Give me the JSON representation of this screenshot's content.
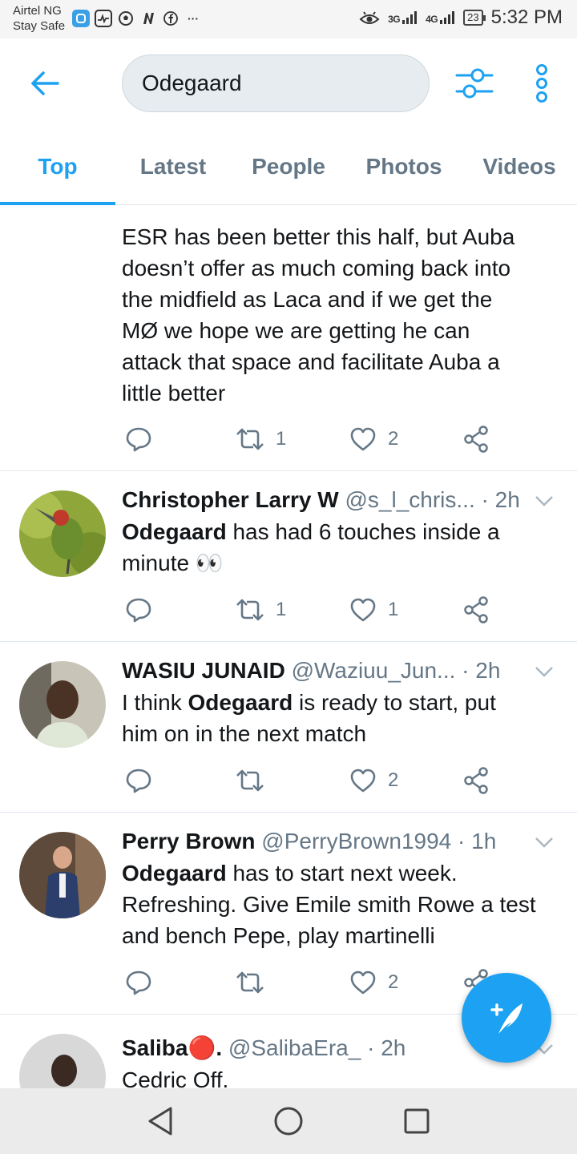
{
  "status_bar": {
    "carrier": "Airtel NG",
    "carrier_sub": "Stay Safe",
    "net_3g": "3G",
    "net_4g": "4G",
    "battery": "23",
    "time": "5:32 PM",
    "more_dots": "···"
  },
  "search": {
    "query": "Odegaard"
  },
  "tabs": [
    {
      "label": "Top",
      "active": true
    },
    {
      "label": "Latest"
    },
    {
      "label": "People"
    },
    {
      "label": "Photos"
    },
    {
      "label": "Videos"
    }
  ],
  "tweets": [
    {
      "body_lines": [
        "ESR has been better this half, but Auba",
        "doesn’t offer as much coming back into",
        "the midfield as Laca and if we get the",
        "MØ we hope we are getting he can",
        "attack that space and facilitate Auba a",
        "little better"
      ],
      "retweets": "1",
      "likes": "2"
    },
    {
      "name": "Christopher Larry W",
      "handle": "@s_l_chris...",
      "time": "· 2h",
      "body_bold": "Odegaard",
      "body_rest": " has had 6 touches inside a",
      "body_line2": "minute 👀",
      "retweets": "1",
      "likes": "1"
    },
    {
      "name": "WASIU JUNAID",
      "handle": "@Waziuu_Jun...",
      "time": "· 2h",
      "body_pre": "I think ",
      "body_bold": "Odegaard",
      "body_rest": " is ready to start, put",
      "body_line2": "him on in the next match",
      "retweets": "",
      "likes": "2"
    },
    {
      "name": "Perry Brown",
      "handle": "@PerryBrown1994",
      "time": "· 1h",
      "body_bold": "Odegaard",
      "body_rest": " has to start next week.",
      "body_line2": "Refreshing. Give Emile smith Rowe a test",
      "body_line3": "and bench Pepe, play martinelli",
      "retweets": "",
      "likes": "2"
    },
    {
      "name": "Saliba🔴.",
      "handle": "@SalibaEra_",
      "time": "· 2h",
      "body_line1": "Cedric Off."
    }
  ],
  "colors": {
    "accent": "#1da1f2",
    "secondary_text": "#657786",
    "divider": "#e1e8ed"
  }
}
